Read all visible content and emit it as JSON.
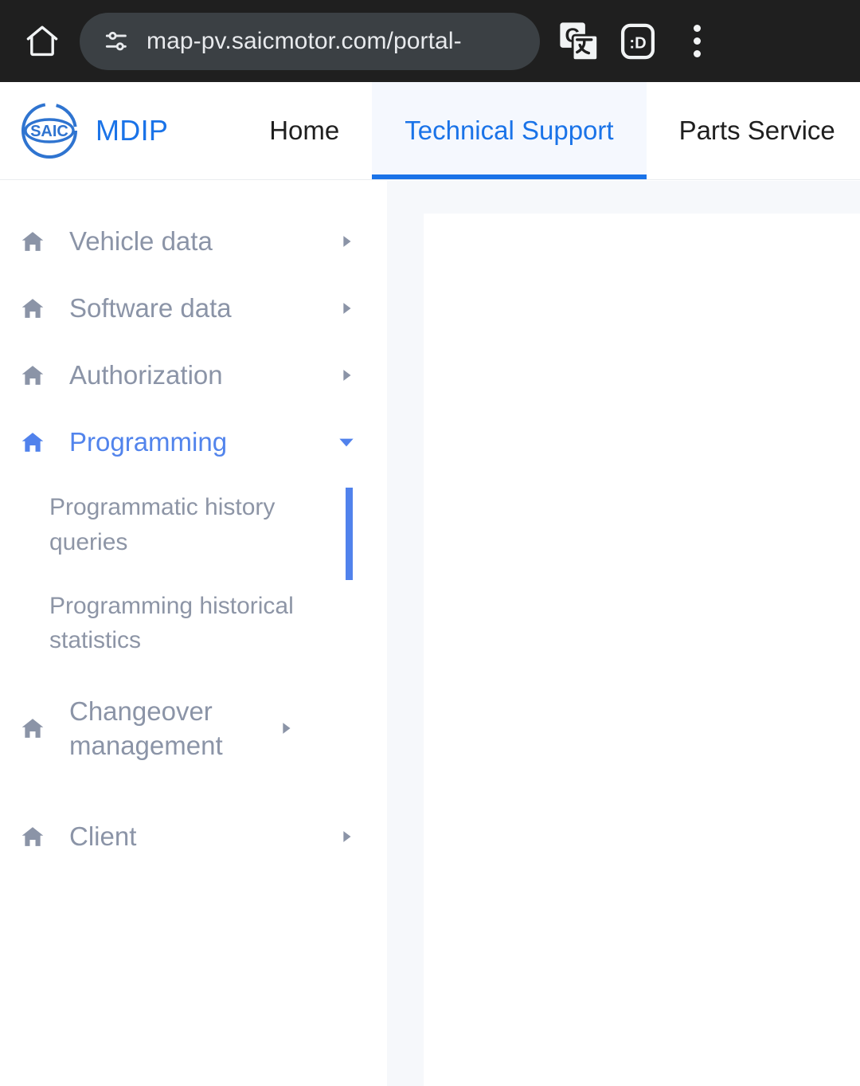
{
  "browser": {
    "home_icon": "home-outline-icon",
    "site_info_icon": "tune-sliders-icon",
    "url": "map-pv.saicmotor.com/portal-",
    "translate_icon": "google-translate-icon",
    "tab_count_icon": ":D",
    "menu_icon": "three-dot-overflow-icon"
  },
  "header": {
    "logo_text": "SAIC",
    "brand": "MDIP",
    "tabs": [
      {
        "label": "Home",
        "active": false
      },
      {
        "label": "Technical Support",
        "active": true
      },
      {
        "label": "Parts Service",
        "active": false
      }
    ]
  },
  "sidebar": {
    "items": [
      {
        "label": "Vehicle data",
        "icon": "home-icon",
        "caret": "chevron-right-icon",
        "active": false,
        "expanded": false
      },
      {
        "label": "Software data",
        "icon": "home-icon",
        "caret": "chevron-right-icon",
        "active": false,
        "expanded": false
      },
      {
        "label": "Authorization",
        "icon": "home-icon",
        "caret": "chevron-right-icon",
        "active": false,
        "expanded": false
      },
      {
        "label": "Programming",
        "icon": "home-icon",
        "caret": "chevron-down-icon",
        "active": true,
        "expanded": true
      },
      {
        "label": "Changeover management",
        "icon": "home-icon",
        "caret": "chevron-right-icon",
        "active": false,
        "expanded": false
      },
      {
        "label": "Client",
        "icon": "home-icon",
        "caret": "chevron-right-icon",
        "active": false,
        "expanded": false
      }
    ],
    "programming_children": [
      {
        "label": "Programmatic history queries"
      },
      {
        "label": "Programming historical statistics"
      }
    ]
  },
  "colors": {
    "accent_blue": "#1a73e8",
    "sidebar_active_blue": "#5182ec",
    "muted_text": "#8b94a7",
    "chrome_bg": "#1f1f1f",
    "url_pill_bg": "#3b4044",
    "page_bg": "#f6f8fb"
  }
}
